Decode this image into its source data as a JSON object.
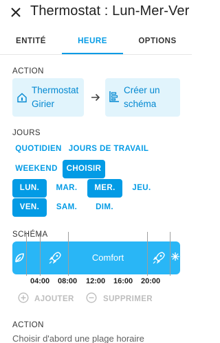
{
  "header": {
    "title": "Thermostat : Lun-Mer-Ver"
  },
  "tabs": [
    {
      "label": "ENTITÉ"
    },
    {
      "label": "HEURE"
    },
    {
      "label": "OPTIONS"
    }
  ],
  "action_section": {
    "label": "ACTION",
    "entity_card": {
      "line1": "Thermostat",
      "line2": "Girier",
      "icon": "thermostat-home-icon"
    },
    "schema_card": {
      "line1": "Créer un",
      "line2": "schéma",
      "icon": "chart-timeline-icon"
    }
  },
  "days_section": {
    "label": "JOURS",
    "presets": [
      {
        "label": "QUOTIDIEN",
        "selected": false
      },
      {
        "label": "JOURS DE TRAVAIL",
        "selected": false
      },
      {
        "label": "WEEKEND",
        "selected": false
      },
      {
        "label": "CHOISIR",
        "selected": true
      }
    ],
    "days": [
      {
        "label": "LUN.",
        "selected": true
      },
      {
        "label": "MAR.",
        "selected": false
      },
      {
        "label": "MER.",
        "selected": true
      },
      {
        "label": "JEU.",
        "selected": false
      },
      {
        "label": "VEN.",
        "selected": true
      },
      {
        "label": "SAM.",
        "selected": false
      },
      {
        "label": "DIM.",
        "selected": false
      }
    ]
  },
  "schema_section": {
    "label": "SCHÉMA",
    "segments": [
      {
        "icon": "leaf-icon"
      },
      {
        "icon": "rocket-icon"
      },
      {
        "label": "Comfort"
      },
      {
        "icon": "rocket-icon"
      },
      {
        "icon": "snowflake-icon"
      }
    ],
    "times": [
      "04:00",
      "08:00",
      "12:00",
      "16:00",
      "20:00"
    ],
    "add_label": "AJOUTER",
    "remove_label": "SUPPRIMER"
  },
  "bottom_section": {
    "label": "ACTION",
    "text": "Choisir d'abord une plage horaire"
  },
  "colors": {
    "accent": "#039be5",
    "segment": "#29b6f6",
    "card_bg": "#e1f4fc"
  }
}
